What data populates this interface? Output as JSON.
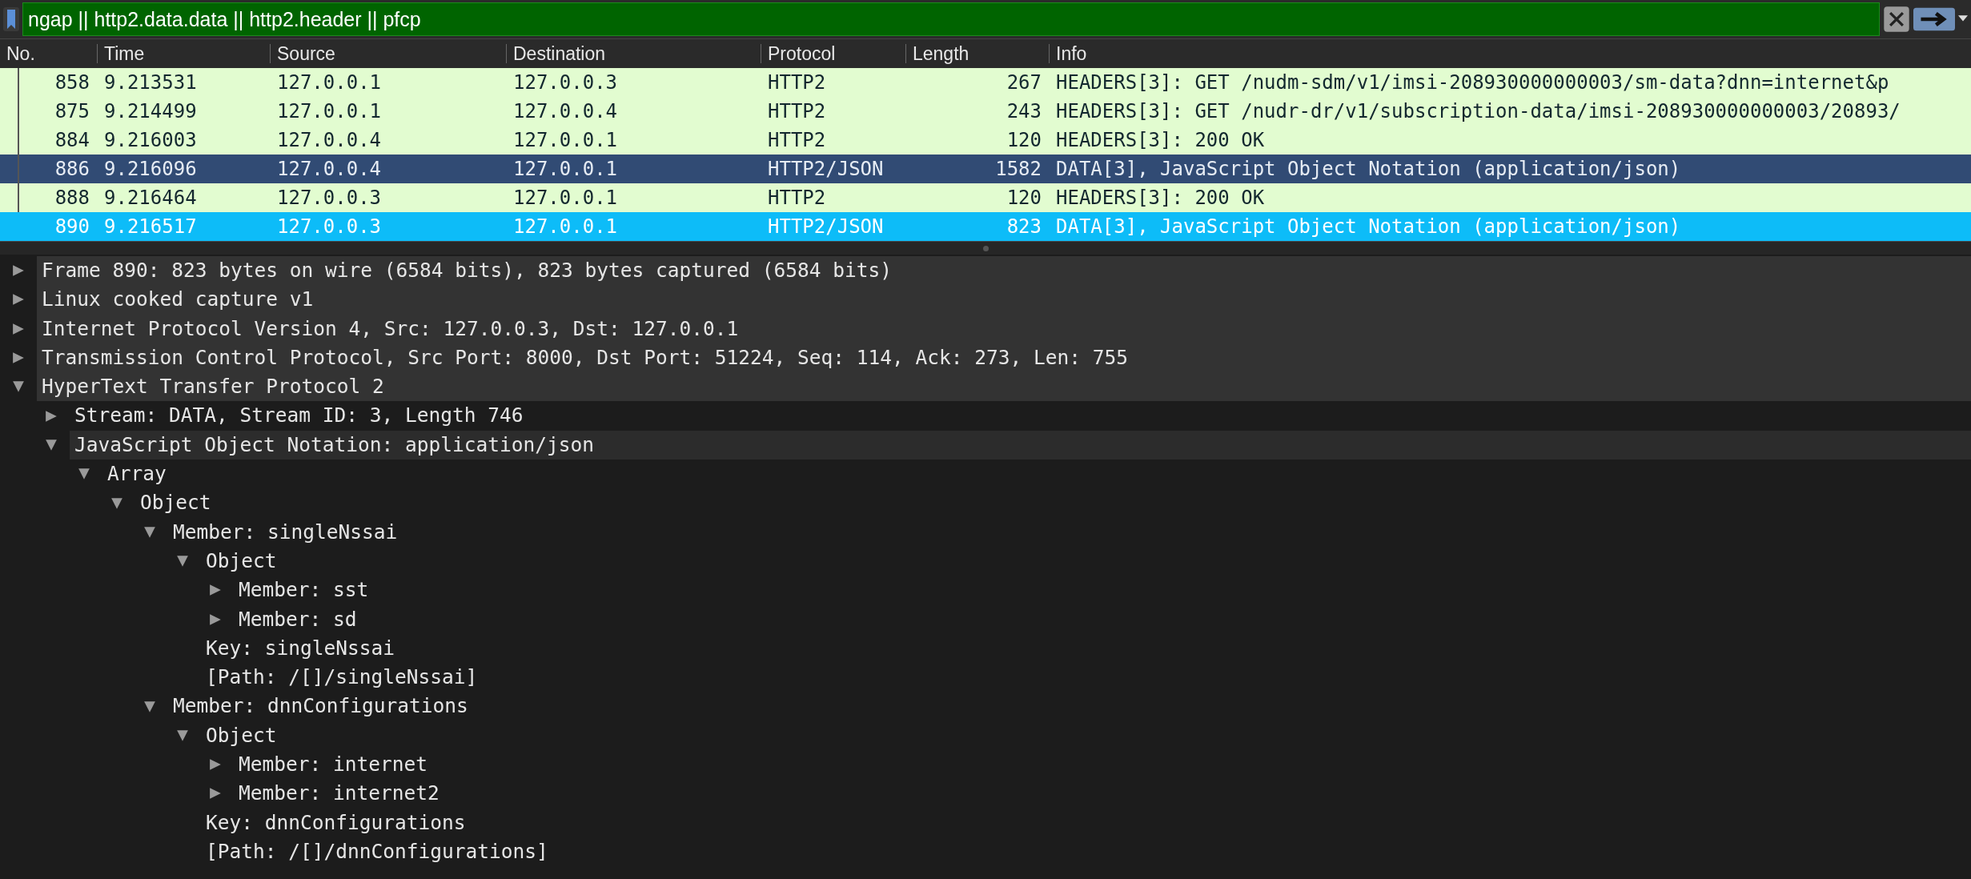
{
  "filter_bar": {
    "value": "ngap || http2.data.data || http2.header || pfcp"
  },
  "packet_list": {
    "columns": [
      "No.",
      "Time",
      "Source",
      "Destination",
      "Protocol",
      "Length",
      "Info"
    ],
    "packets": [
      {
        "cells": [
          "858",
          "9.213531",
          "127.0.0.1",
          "127.0.0.3",
          "HTTP2",
          "267",
          "HEADERS[3]: GET /nudm-sdm/v1/imsi-208930000000003/sm-data?dnn=internet&p"
        ],
        "related": true,
        "highlighted": false,
        "selected": false
      },
      {
        "cells": [
          "875",
          "9.214499",
          "127.0.0.1",
          "127.0.0.4",
          "HTTP2",
          "243",
          "HEADERS[3]: GET /nudr-dr/v1/subscription-data/imsi-208930000000003/20893/"
        ],
        "related": true,
        "highlighted": false,
        "selected": false
      },
      {
        "cells": [
          "884",
          "9.216003",
          "127.0.0.4",
          "127.0.0.1",
          "HTTP2",
          "120",
          "HEADERS[3]: 200 OK"
        ],
        "related": true,
        "highlighted": false,
        "selected": false
      },
      {
        "cells": [
          "886",
          "9.216096",
          "127.0.0.4",
          "127.0.0.1",
          "HTTP2/JSON",
          "1582",
          "DATA[3], JavaScript Object Notation (application/json)"
        ],
        "related": true,
        "highlighted": true,
        "selected": false
      },
      {
        "cells": [
          "888",
          "9.216464",
          "127.0.0.3",
          "127.0.0.1",
          "HTTP2",
          "120",
          "HEADERS[3]: 200 OK"
        ],
        "related": true,
        "highlighted": false,
        "selected": false
      },
      {
        "cells": [
          "890",
          "9.216517",
          "127.0.0.3",
          "127.0.0.1",
          "HTTP2/JSON",
          "823",
          "DATA[3], JavaScript Object Notation (application/json)"
        ],
        "related": false,
        "highlighted": false,
        "selected": true
      }
    ]
  },
  "details": [
    {
      "label": "Frame 890: 823 bytes on wire (6584 bits), 823 bytes captured (6584 bits)",
      "expanded": false,
      "selected": false
    },
    {
      "label": "Linux cooked capture v1",
      "expanded": false,
      "selected": false
    },
    {
      "label": "Internet Protocol Version 4, Src: 127.0.0.3, Dst: 127.0.0.1",
      "expanded": false,
      "selected": false
    },
    {
      "label": "Transmission Control Protocol, Src Port: 8000, Dst Port: 51224, Seq: 114, Ack: 273, Len: 755",
      "expanded": false,
      "selected": false
    },
    {
      "label": "HyperText Transfer Protocol 2",
      "expanded": true,
      "selected": false,
      "children": [
        {
          "label": "Stream: DATA, Stream ID: 3, Length 746",
          "expanded": false,
          "selected": false
        },
        {
          "label": "JavaScript Object Notation: application/json",
          "expanded": true,
          "selected": true,
          "children": [
            {
              "label": "Array",
              "expanded": true,
              "selected": false,
              "children": [
                {
                  "label": "Object",
                  "expanded": true,
                  "selected": false,
                  "children": [
                    {
                      "label": "Member: singleNssai",
                      "expanded": true,
                      "selected": false,
                      "children": [
                        {
                          "label": "Object",
                          "expanded": true,
                          "selected": false,
                          "children": [
                            {
                              "label": "Member: sst",
                              "expanded": false,
                              "selected": false
                            },
                            {
                              "label": "Member: sd",
                              "expanded": false,
                              "selected": false
                            }
                          ]
                        },
                        {
                          "label": "Key: singleNssai",
                          "selected": false
                        },
                        {
                          "label": "[Path: /[]/singleNssai]",
                          "selected": false
                        }
                      ]
                    },
                    {
                      "label": "Member: dnnConfigurations",
                      "expanded": true,
                      "selected": false,
                      "children": [
                        {
                          "label": "Object",
                          "expanded": true,
                          "selected": false,
                          "children": [
                            {
                              "label": "Member: internet",
                              "expanded": false,
                              "selected": false
                            },
                            {
                              "label": "Member: internet2",
                              "expanded": false,
                              "selected": false
                            }
                          ]
                        },
                        {
                          "label": "Key: dnnConfigurations",
                          "selected": false
                        },
                        {
                          "label": "[Path: /[]/dnnConfigurations]",
                          "selected": false
                        }
                      ]
                    }
                  ]
                }
              ]
            }
          ]
        }
      ]
    }
  ]
}
